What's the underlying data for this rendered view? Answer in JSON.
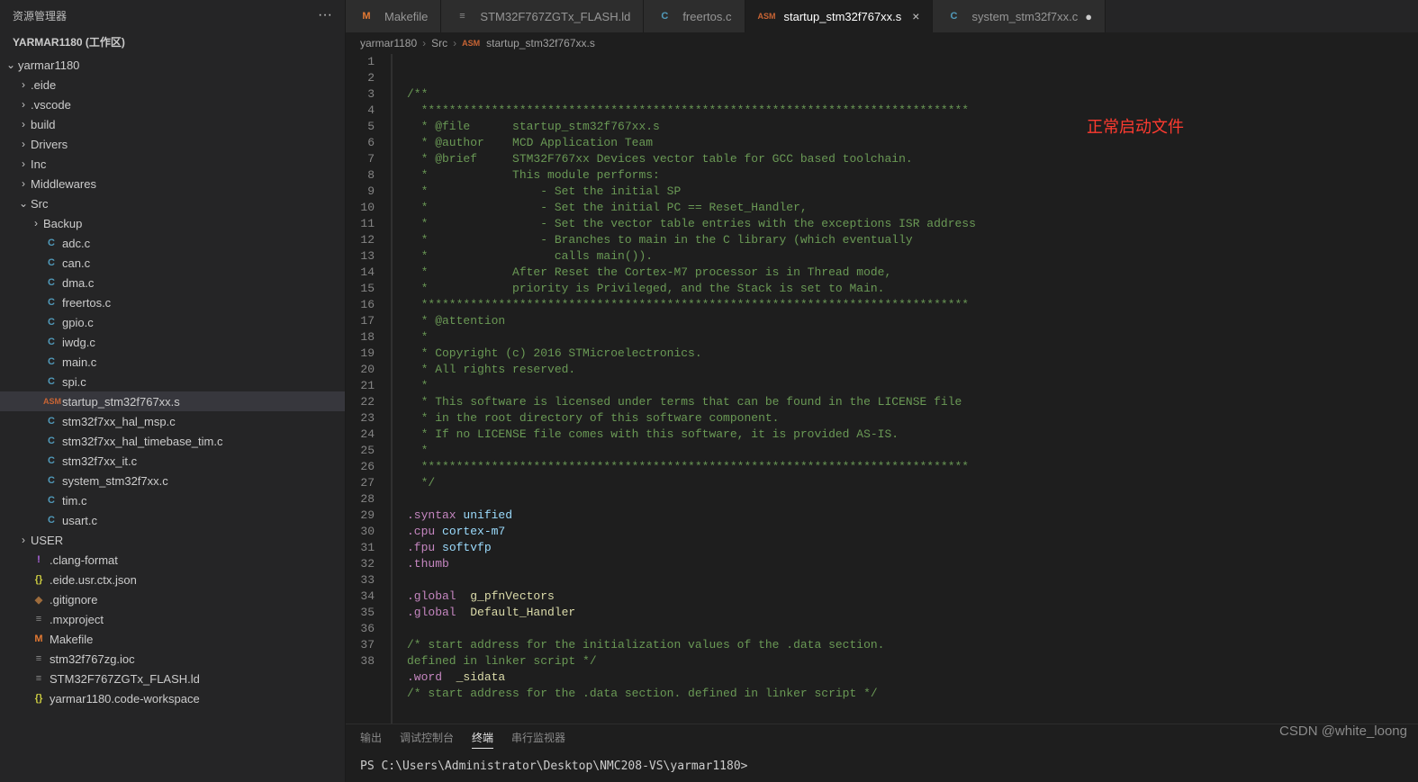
{
  "sidebar": {
    "title": "资源管理器",
    "workspace": "YARMAR1180 (工作区)",
    "root": "yarmar1180",
    "folders": [
      {
        "name": ".eide",
        "open": false
      },
      {
        "name": ".vscode",
        "open": false
      },
      {
        "name": "build",
        "open": false
      },
      {
        "name": "Drivers",
        "open": false
      },
      {
        "name": "Inc",
        "open": false
      },
      {
        "name": "Middlewares",
        "open": false
      }
    ],
    "src_label": "Src",
    "backup_label": "Backup",
    "src_files": [
      {
        "name": "adc.c",
        "icon": "C",
        "cls": "ic-c"
      },
      {
        "name": "can.c",
        "icon": "C",
        "cls": "ic-c"
      },
      {
        "name": "dma.c",
        "icon": "C",
        "cls": "ic-c"
      },
      {
        "name": "freertos.c",
        "icon": "C",
        "cls": "ic-c"
      },
      {
        "name": "gpio.c",
        "icon": "C",
        "cls": "ic-c"
      },
      {
        "name": "iwdg.c",
        "icon": "C",
        "cls": "ic-c"
      },
      {
        "name": "main.c",
        "icon": "C",
        "cls": "ic-c"
      },
      {
        "name": "spi.c",
        "icon": "C",
        "cls": "ic-c"
      },
      {
        "name": "startup_stm32f767xx.s",
        "icon": "ASM",
        "cls": "ic-asm"
      },
      {
        "name": "stm32f7xx_hal_msp.c",
        "icon": "C",
        "cls": "ic-c"
      },
      {
        "name": "stm32f7xx_hal_timebase_tim.c",
        "icon": "C",
        "cls": "ic-c"
      },
      {
        "name": "stm32f7xx_it.c",
        "icon": "C",
        "cls": "ic-c"
      },
      {
        "name": "system_stm32f7xx.c",
        "icon": "C",
        "cls": "ic-c"
      },
      {
        "name": "tim.c",
        "icon": "C",
        "cls": "ic-c"
      },
      {
        "name": "usart.c",
        "icon": "C",
        "cls": "ic-c"
      }
    ],
    "user_label": "USER",
    "root_files": [
      {
        "name": ".clang-format",
        "icon": "!",
        "cls": "ic-bang"
      },
      {
        "name": ".eide.usr.ctx.json",
        "icon": "{}",
        "cls": "ic-json"
      },
      {
        "name": ".gitignore",
        "icon": "◆",
        "cls": "ic-git"
      },
      {
        "name": ".mxproject",
        "icon": "≡",
        "cls": "ic-txt"
      },
      {
        "name": "Makefile",
        "icon": "M",
        "cls": "ic-make"
      },
      {
        "name": "stm32f767zg.ioc",
        "icon": "≡",
        "cls": "ic-txt"
      },
      {
        "name": "STM32F767ZGTx_FLASH.ld",
        "icon": "≡",
        "cls": "ic-txt"
      },
      {
        "name": "yarmar1180.code-workspace",
        "icon": "{}",
        "cls": "ic-json"
      }
    ]
  },
  "tabs": [
    {
      "label": "Makefile",
      "icon": "M",
      "cls": "ic-make",
      "active": false,
      "dirty": false
    },
    {
      "label": "STM32F767ZGTx_FLASH.ld",
      "icon": "≡",
      "cls": "ic-txt",
      "active": false,
      "dirty": false
    },
    {
      "label": "freertos.c",
      "icon": "C",
      "cls": "ic-c",
      "active": false,
      "dirty": false
    },
    {
      "label": "startup_stm32f767xx.s",
      "icon": "ASM",
      "cls": "ic-asm",
      "active": true,
      "dirty": false
    },
    {
      "label": "system_stm32f7xx.c",
      "icon": "C",
      "cls": "ic-c",
      "active": false,
      "dirty": true
    }
  ],
  "breadcrumb": {
    "p1": "yarmar1180",
    "p2": "Src",
    "p3": "startup_stm32f767xx.s",
    "icon": "ASM"
  },
  "annotation": "正常启动文件",
  "code_lines": [
    {
      "n": 1,
      "t": "/**",
      "c": "c-comment"
    },
    {
      "n": 2,
      "t": "  ******************************************************************************",
      "c": "c-comment"
    },
    {
      "n": 3,
      "t": "  * @file      startup_stm32f767xx.s",
      "c": "c-comment"
    },
    {
      "n": 4,
      "t": "  * @author    MCD Application Team",
      "c": "c-comment"
    },
    {
      "n": 5,
      "t": "  * @brief     STM32F767xx Devices vector table for GCC based toolchain.",
      "c": "c-comment"
    },
    {
      "n": 6,
      "t": "  *            This module performs:",
      "c": "c-comment"
    },
    {
      "n": 7,
      "t": "  *                - Set the initial SP",
      "c": "c-comment"
    },
    {
      "n": 8,
      "t": "  *                - Set the initial PC == Reset_Handler,",
      "c": "c-comment"
    },
    {
      "n": 9,
      "t": "  *                - Set the vector table entries with the exceptions ISR address",
      "c": "c-comment"
    },
    {
      "n": 10,
      "t": "  *                - Branches to main in the C library (which eventually",
      "c": "c-comment"
    },
    {
      "n": 11,
      "t": "  *                  calls main()).",
      "c": "c-comment"
    },
    {
      "n": 12,
      "t": "  *            After Reset the Cortex-M7 processor is in Thread mode,",
      "c": "c-comment"
    },
    {
      "n": 13,
      "t": "  *            priority is Privileged, and the Stack is set to Main.",
      "c": "c-comment"
    },
    {
      "n": 14,
      "t": "  ******************************************************************************",
      "c": "c-comment"
    },
    {
      "n": 15,
      "t": "  * @attention",
      "c": "c-comment"
    },
    {
      "n": 16,
      "t": "  *",
      "c": "c-comment"
    },
    {
      "n": 17,
      "t": "  * Copyright (c) 2016 STMicroelectronics.",
      "c": "c-comment"
    },
    {
      "n": 18,
      "t": "  * All rights reserved.",
      "c": "c-comment"
    },
    {
      "n": 19,
      "t": "  *",
      "c": "c-comment"
    },
    {
      "n": 20,
      "t": "  * This software is licensed under terms that can be found in the LICENSE file",
      "c": "c-comment"
    },
    {
      "n": 21,
      "t": "  * in the root directory of this software component.",
      "c": "c-comment"
    },
    {
      "n": 22,
      "t": "  * If no LICENSE file comes with this software, it is provided AS-IS.",
      "c": "c-comment"
    },
    {
      "n": 23,
      "t": "  *",
      "c": "c-comment"
    },
    {
      "n": 24,
      "t": "  ******************************************************************************",
      "c": "c-comment"
    },
    {
      "n": 25,
      "t": "  */",
      "c": "c-comment"
    },
    {
      "n": 26,
      "t": "",
      "c": ""
    },
    {
      "n": 27,
      "t": "  ",
      "segs": [
        {
          "t": ".syntax ",
          "c": "c-dir"
        },
        {
          "t": "unified",
          "c": "c-arg"
        }
      ]
    },
    {
      "n": 28,
      "t": "  ",
      "segs": [
        {
          "t": ".cpu ",
          "c": "c-dir"
        },
        {
          "t": "cortex-m7",
          "c": "c-arg"
        }
      ]
    },
    {
      "n": 29,
      "t": "  ",
      "segs": [
        {
          "t": ".fpu ",
          "c": "c-dir"
        },
        {
          "t": "softvfp",
          "c": "c-arg"
        }
      ]
    },
    {
      "n": 30,
      "t": "  ",
      "segs": [
        {
          "t": ".thumb",
          "c": "c-dir"
        }
      ]
    },
    {
      "n": 31,
      "t": "",
      "c": ""
    },
    {
      "n": 32,
      "t": "",
      "segs": [
        {
          "t": ".global  ",
          "c": "c-dir"
        },
        {
          "t": "g_pfnVectors",
          "c": "c-sym"
        }
      ]
    },
    {
      "n": 33,
      "t": "",
      "segs": [
        {
          "t": ".global  ",
          "c": "c-dir"
        },
        {
          "t": "Default_Handler",
          "c": "c-sym"
        }
      ]
    },
    {
      "n": 34,
      "t": "",
      "c": ""
    },
    {
      "n": 35,
      "t": "/* start address for the initialization values of the .data section.",
      "c": "c-comment"
    },
    {
      "n": 36,
      "t": "defined in linker script */",
      "c": "c-comment"
    },
    {
      "n": 37,
      "t": "  ",
      "segs": [
        {
          "t": ".word  ",
          "c": "c-dir"
        },
        {
          "t": "_sidata",
          "c": "c-sym"
        }
      ]
    },
    {
      "n": 38,
      "t": "/* start address for the .data section. defined in linker script */",
      "c": "c-comment"
    }
  ],
  "panel": {
    "tabs": [
      "输出",
      "调试控制台",
      "终端",
      "串行监视器"
    ],
    "active": 2,
    "terminal_line": "PS C:\\Users\\Administrator\\Desktop\\NMC208-VS\\yarmar1180>"
  },
  "watermark": "CSDN @white_loong"
}
